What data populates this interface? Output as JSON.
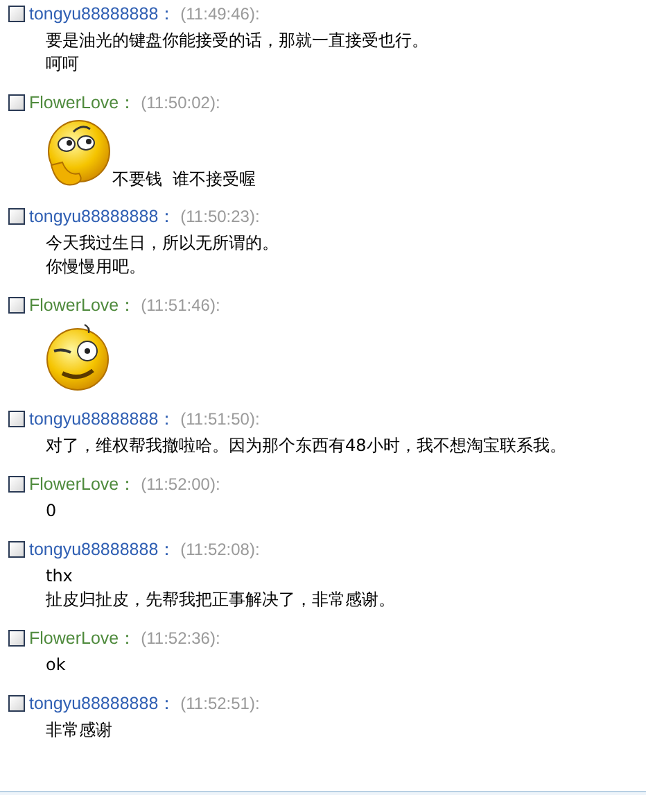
{
  "messages": [
    {
      "sender": "tongyu88888888",
      "separator": "：",
      "time": "(11:49:46):",
      "color": "#2f5fb3",
      "kind": "text",
      "lines": [
        "要是油光的键盘你能接受的话，那就一直接受也行。",
        "呵呵"
      ]
    },
    {
      "sender": "FlowerLove",
      "separator": "：",
      "time": "(11:50:02):",
      "color": "#4e8a3c",
      "kind": "thinking",
      "caption": "不要钱  谁不接受喔"
    },
    {
      "sender": "tongyu88888888",
      "separator": "：",
      "time": "(11:50:23):",
      "color": "#2f5fb3",
      "kind": "text",
      "lines": [
        "今天我过生日，所以无所谓的。",
        "你慢慢用吧。"
      ]
    },
    {
      "sender": "FlowerLove",
      "separator": "：",
      "time": "(11:51:46):",
      "color": "#4e8a3c",
      "kind": "squint"
    },
    {
      "sender": "tongyu88888888",
      "separator": "：",
      "time": "(11:51:50):",
      "color": "#2f5fb3",
      "kind": "text",
      "lines": [
        "对了，维权帮我撤啦哈。因为那个东西有48小时，我不想淘宝联系我。"
      ]
    },
    {
      "sender": "FlowerLove",
      "separator": "：",
      "time": "(11:52:00):",
      "color": "#4e8a3c",
      "kind": "text",
      "lines": [
        "0"
      ]
    },
    {
      "sender": "tongyu88888888",
      "separator": "：",
      "time": "(11:52:08):",
      "color": "#2f5fb3",
      "kind": "text",
      "lines": [
        "thx",
        "扯皮归扯皮，先帮我把正事解决了，非常感谢。"
      ]
    },
    {
      "sender": "FlowerLove",
      "separator": "：",
      "time": "(11:52:36):",
      "color": "#4e8a3c",
      "kind": "text",
      "lines": [
        "ok"
      ]
    },
    {
      "sender": "tongyu88888888",
      "separator": "：",
      "time": "(11:52:51):",
      "color": "#2f5fb3",
      "kind": "text",
      "lines": [
        "非常感谢"
      ]
    }
  ]
}
